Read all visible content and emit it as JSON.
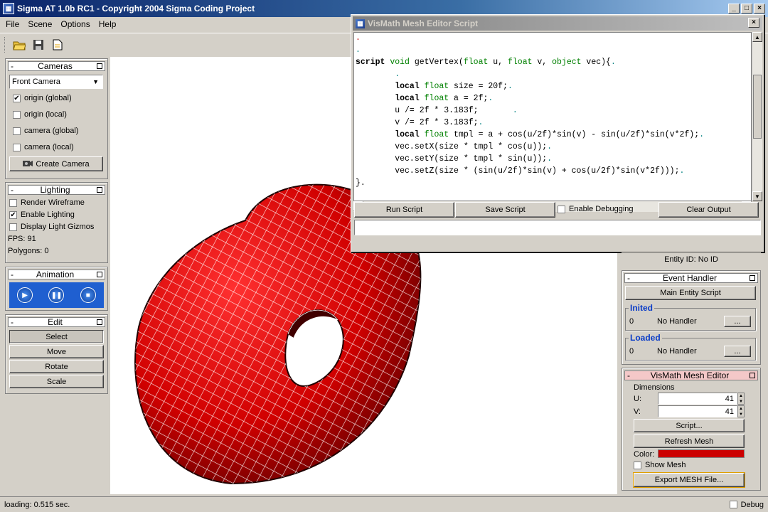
{
  "window": {
    "title": "Sigma AT 1.0b RC1 - Copyright 2004 Sigma Coding Project"
  },
  "menu": [
    "File",
    "Scene",
    "Options",
    "Help"
  ],
  "toolbar": {
    "icons": [
      "open-folder-icon",
      "save-icon",
      "new-document-icon"
    ]
  },
  "cameras": {
    "title": "Cameras",
    "selected": "Front Camera",
    "options": [
      {
        "label": "origin (global)",
        "checked": true
      },
      {
        "label": "origin (local)",
        "checked": false
      },
      {
        "label": "camera (global)",
        "checked": false
      },
      {
        "label": "camera (local)",
        "checked": false
      }
    ],
    "create_button": "Create Camera"
  },
  "lighting": {
    "title": "Lighting",
    "options": [
      {
        "label": "Render Wireframe",
        "checked": false
      },
      {
        "label": "Enable Lighting",
        "checked": true
      },
      {
        "label": "Display Light Gizmos",
        "checked": false
      }
    ],
    "fps": "FPS: 91",
    "polygons": "Polygons: 0"
  },
  "animation": {
    "title": "Animation",
    "buttons": [
      "play-icon",
      "pause-icon",
      "stop-icon"
    ]
  },
  "edit": {
    "title": "Edit",
    "buttons": [
      "Select",
      "Move",
      "Rotate",
      "Scale"
    ]
  },
  "script_window": {
    "title": "VisMath Mesh Editor Script",
    "code_lines": [
      ".",
      ".",
      "script void getVertex(float u, float v, object vec){.",
      "        .",
      "        local float size = 20f;.",
      "        local float a = 2f;.",
      "        u /= 2f * 3.183f;       .",
      "        v /= 2f * 3.183f;.",
      "        local float tmpl = a + cos(u/2f)*sin(v) - sin(u/2f)*sin(v*2f);.",
      "        vec.setX(size * tmpl * cos(u));.",
      "        vec.setY(size * tmpl * sin(u));.",
      "        vec.setZ(size * (sin(u/2f)*sin(v) + cos(u/2f)*sin(v*2f)));.",
      "}."
    ],
    "buttons": {
      "run": "Run Script",
      "save": "Save Script",
      "debug": "Enable Debugging",
      "clear": "Clear Output"
    },
    "output": ""
  },
  "entity": {
    "id_label": "Entity ID: No ID"
  },
  "event_handler": {
    "title": "Event Handler",
    "main_button": "Main Entity Script",
    "groups": [
      {
        "label": "Inited",
        "count": "0",
        "handler": "No Handler",
        "button": "..."
      },
      {
        "label": "Loaded",
        "count": "0",
        "handler": "No Handler",
        "button": "..."
      }
    ]
  },
  "mesh_editor": {
    "title": "VisMath Mesh Editor",
    "dimensions_label": "Dimensions",
    "u_label": "U:",
    "u_value": "41",
    "v_label": "V:",
    "v_value": "41",
    "script_button": "Script...",
    "refresh_button": "Refresh Mesh",
    "color_label": "Color:",
    "color": "#cc0000",
    "show_mesh_label": "Show Mesh",
    "export_button": "Export MESH File..."
  },
  "status": {
    "text": "loading: 0.515 sec.",
    "debug_label": "Debug"
  }
}
